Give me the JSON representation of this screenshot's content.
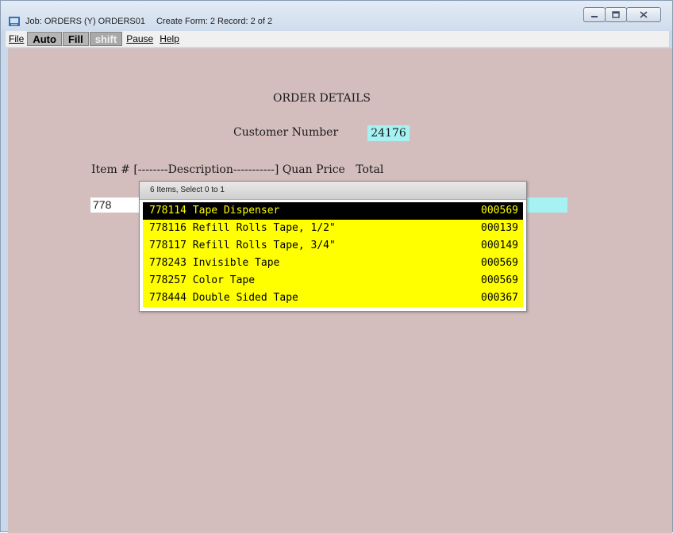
{
  "window": {
    "title_job": "Job: ORDERS  (Y) ORDERS01",
    "title_form": "Create Form: 2 Record: 2 of 2"
  },
  "menu": {
    "file": "File",
    "auto": "Auto",
    "fill": "Fill",
    "shift": "shift",
    "pause": "Pause",
    "help": "Help"
  },
  "screen": {
    "heading": "ORDER DETAILS",
    "customer_label": "Customer Number",
    "customer_value": "24176",
    "columns_header": "Item # [--------Description-----------] Quan Price   Total",
    "item_input_value": "778"
  },
  "popup": {
    "header": "6 Items, Select 0 to 1",
    "items": [
      {
        "code": "778114",
        "desc": "Tape Dispenser",
        "price": "000569"
      },
      {
        "code": "778116",
        "desc": "Refill Rolls Tape, 1/2\"",
        "price": "000139"
      },
      {
        "code": "778117",
        "desc": "Refill Rolls Tape, 3/4\"",
        "price": "000149"
      },
      {
        "code": "778243",
        "desc": "Invisible Tape",
        "price": "000569"
      },
      {
        "code": "778257",
        "desc": "Color Tape",
        "price": "000569"
      },
      {
        "code": "778444",
        "desc": "Double Sided Tape",
        "price": "000367"
      }
    ],
    "selected_index": 0
  },
  "colors": {
    "screen_bg": "#d3bdbd",
    "field_cyan": "#a6f2f2",
    "popup_row": "#ffff00",
    "popup_selected_bg": "#000000",
    "popup_selected_fg": "#ffff00"
  }
}
